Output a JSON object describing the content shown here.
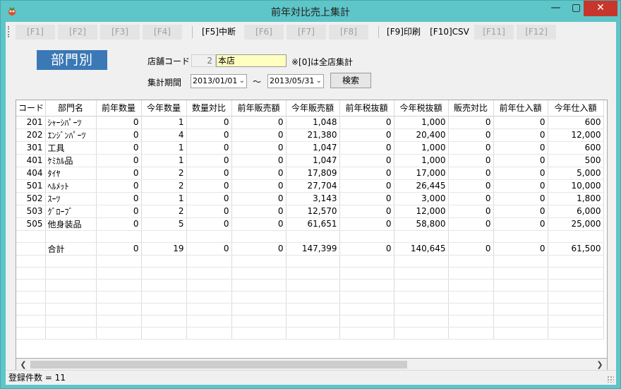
{
  "window": {
    "title": "前年対比売上集計",
    "buttons": {
      "minimize": "—",
      "maximize": "▢",
      "close": "✕"
    }
  },
  "toolbar": {
    "keys": [
      {
        "label": "[F1]",
        "enabled": false
      },
      {
        "label": "[F2]",
        "enabled": false
      },
      {
        "label": "[F3]",
        "enabled": false
      },
      {
        "label": "[F4]",
        "enabled": false
      },
      {
        "label": "[F5]中断",
        "enabled": true
      },
      {
        "label": "[F6]",
        "enabled": false
      },
      {
        "label": "[F7]",
        "enabled": false
      },
      {
        "label": "[F8]",
        "enabled": false
      },
      {
        "label": "[F9]印刷",
        "enabled": true
      },
      {
        "label": "[F10]CSV",
        "enabled": true
      },
      {
        "label": "[F11]",
        "enabled": false
      },
      {
        "label": "[F12]",
        "enabled": false
      }
    ]
  },
  "form": {
    "mode_badge": "部門別",
    "store_code_label": "店舗コード",
    "store_code_value": "2",
    "store_name_value": "本店",
    "store_note": "※[0]は全店集計",
    "period_label": "集計期間",
    "date_from": "2013/01/01",
    "date_sep": "〜",
    "date_to": "2013/05/31",
    "search_button": "検索"
  },
  "grid": {
    "columns": [
      "コード",
      "部門名",
      "前年数量",
      "今年数量",
      "数量対比",
      "前年販売額",
      "今年販売額",
      "前年税抜額",
      "今年税抜額",
      "販売対比",
      "前年仕入額",
      "今年仕入額"
    ],
    "rows": [
      [
        "201",
        "ｼｬｰｼﾊﾟｰﾂ",
        "0",
        "1",
        "0",
        "0",
        "1,048",
        "0",
        "1,000",
        "0",
        "0",
        "600"
      ],
      [
        "202",
        "ｴﾝｼﾞﾝﾊﾟｰﾂ",
        "0",
        "4",
        "0",
        "0",
        "21,380",
        "0",
        "20,400",
        "0",
        "0",
        "12,000"
      ],
      [
        "301",
        "工具",
        "0",
        "1",
        "0",
        "0",
        "1,047",
        "0",
        "1,000",
        "0",
        "0",
        "600"
      ],
      [
        "401",
        "ｹﾐｶﾙ品",
        "0",
        "1",
        "0",
        "0",
        "1,047",
        "0",
        "1,000",
        "0",
        "0",
        "500"
      ],
      [
        "404",
        "ﾀｲﾔ",
        "0",
        "2",
        "0",
        "0",
        "17,809",
        "0",
        "17,000",
        "0",
        "0",
        "5,000"
      ],
      [
        "501",
        "ﾍﾙﾒｯﾄ",
        "0",
        "2",
        "0",
        "0",
        "27,704",
        "0",
        "26,445",
        "0",
        "0",
        "10,000"
      ],
      [
        "502",
        "ｽｰﾂ",
        "0",
        "1",
        "0",
        "0",
        "3,143",
        "0",
        "3,000",
        "0",
        "0",
        "1,800"
      ],
      [
        "503",
        "ｸﾞﾛｰﾌﾞ",
        "0",
        "2",
        "0",
        "0",
        "12,570",
        "0",
        "12,000",
        "0",
        "0",
        "6,000"
      ],
      [
        "505",
        "他身装品",
        "0",
        "5",
        "0",
        "0",
        "61,651",
        "0",
        "58,800",
        "0",
        "0",
        "25,000"
      ],
      [
        "",
        "",
        "",
        "",
        "",
        "",
        "",
        "",
        "",
        "",
        "",
        ""
      ],
      [
        "",
        "合計",
        "0",
        "19",
        "0",
        "0",
        "147,399",
        "0",
        "140,645",
        "0",
        "0",
        "61,500"
      ]
    ]
  },
  "status": {
    "record_count": "登録件数 = 11"
  }
}
